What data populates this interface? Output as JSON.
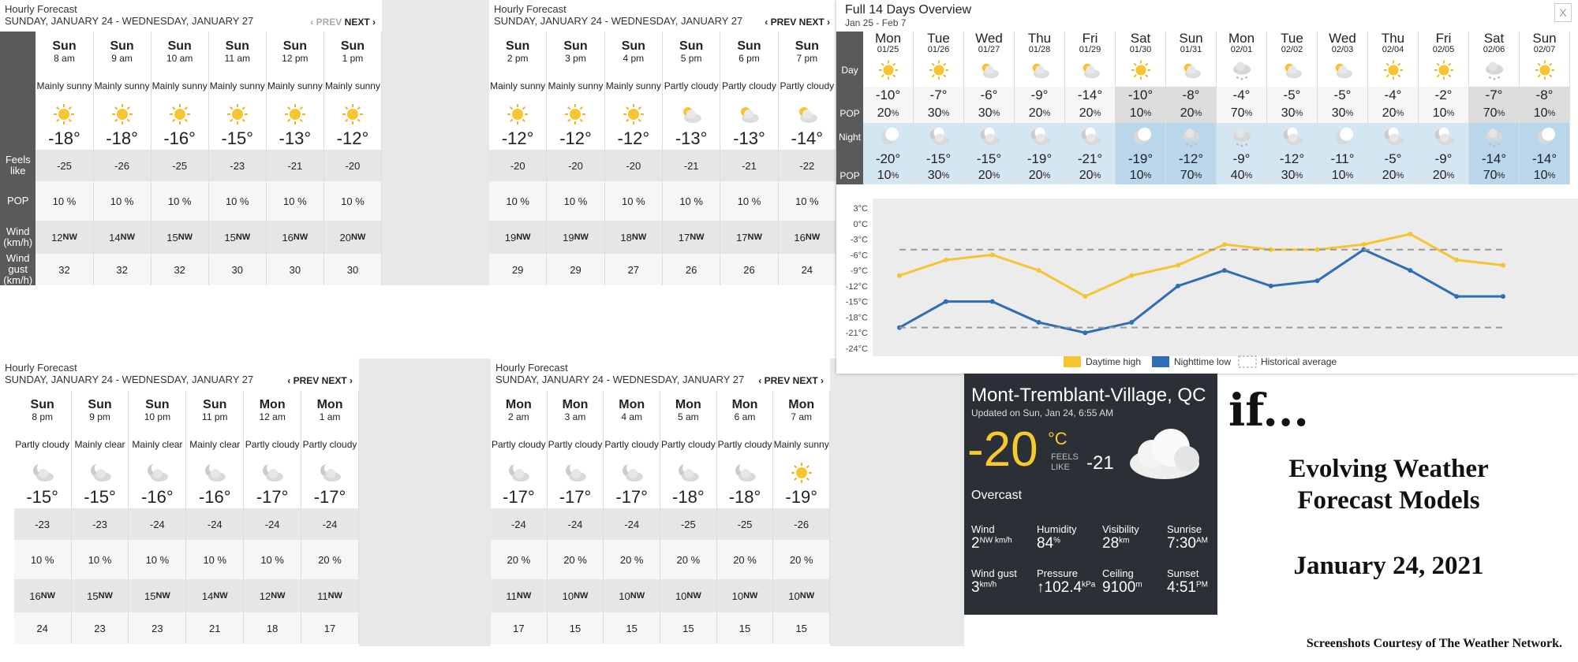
{
  "hourly_common": {
    "title": "Hourly Forecast",
    "subtitle": "SUNDAY, JANUARY 24 - WEDNESDAY, JANUARY 27",
    "prev": "‹ PREV",
    "next": "NEXT ›",
    "labels": {
      "feels": "Feels like",
      "pop": "POP",
      "wind": "Wind (km/h)",
      "gust": "Wind gust (km/h)"
    }
  },
  "panel1": [
    {
      "day": "Sun",
      "time": "8 am",
      "cond": "Mainly sunny",
      "icon": "sun-icon",
      "temp": "-18°",
      "feels": "-25",
      "pop": "10 %",
      "wind": "12",
      "dir": "NW",
      "gust": "32"
    },
    {
      "day": "Sun",
      "time": "9 am",
      "cond": "Mainly sunny",
      "icon": "sun-icon",
      "temp": "-18°",
      "feels": "-26",
      "pop": "10 %",
      "wind": "14",
      "dir": "NW",
      "gust": "32"
    },
    {
      "day": "Sun",
      "time": "10 am",
      "cond": "Mainly sunny",
      "icon": "sun-icon",
      "temp": "-16°",
      "feels": "-25",
      "pop": "10 %",
      "wind": "15",
      "dir": "NW",
      "gust": "32"
    },
    {
      "day": "Sun",
      "time": "11 am",
      "cond": "Mainly sunny",
      "icon": "sun-icon",
      "temp": "-15°",
      "feels": "-23",
      "pop": "10 %",
      "wind": "15",
      "dir": "NW",
      "gust": "30"
    },
    {
      "day": "Sun",
      "time": "12 pm",
      "cond": "Mainly sunny",
      "icon": "sun-icon",
      "temp": "-13°",
      "feels": "-21",
      "pop": "10 %",
      "wind": "16",
      "dir": "NW",
      "gust": "30"
    },
    {
      "day": "Sun",
      "time": "1 pm",
      "cond": "Mainly sunny",
      "icon": "sun-icon",
      "temp": "-12°",
      "feels": "-20",
      "pop": "10 %",
      "wind": "20",
      "dir": "NW",
      "gust": "30"
    }
  ],
  "panel2": [
    {
      "day": "Sun",
      "time": "2 pm",
      "cond": "Mainly sunny",
      "icon": "sun-icon",
      "temp": "-12°",
      "feels": "-20",
      "pop": "10 %",
      "wind": "19",
      "dir": "NW",
      "gust": "29"
    },
    {
      "day": "Sun",
      "time": "3 pm",
      "cond": "Mainly sunny",
      "icon": "sun-icon",
      "temp": "-12°",
      "feels": "-20",
      "pop": "10 %",
      "wind": "19",
      "dir": "NW",
      "gust": "29"
    },
    {
      "day": "Sun",
      "time": "4 pm",
      "cond": "Mainly sunny",
      "icon": "sun-icon",
      "temp": "-12°",
      "feels": "-20",
      "pop": "10 %",
      "wind": "18",
      "dir": "NW",
      "gust": "27"
    },
    {
      "day": "Sun",
      "time": "5 pm",
      "cond": "Partly cloudy",
      "icon": "cloud-icon",
      "temp": "-13°",
      "feels": "-21",
      "pop": "10 %",
      "wind": "17",
      "dir": "NW",
      "gust": "26"
    },
    {
      "day": "Sun",
      "time": "6 pm",
      "cond": "Partly cloudy",
      "icon": "cloud-icon",
      "temp": "-13°",
      "feels": "-21",
      "pop": "10 %",
      "wind": "17",
      "dir": "NW",
      "gust": "26"
    },
    {
      "day": "Sun",
      "time": "7 pm",
      "cond": "Partly cloudy",
      "icon": "cloud-icon",
      "temp": "-14°",
      "feels": "-22",
      "pop": "10 %",
      "wind": "16",
      "dir": "NW",
      "gust": "24"
    }
  ],
  "panel3": [
    {
      "day": "Sun",
      "time": "8 pm",
      "cond": "Partly cloudy",
      "icon": "moon-cloud-icon",
      "temp": "-15°",
      "feels": "-23",
      "pop": "10 %",
      "wind": "16",
      "dir": "NW",
      "gust": "24"
    },
    {
      "day": "Sun",
      "time": "9 pm",
      "cond": "Mainly clear",
      "icon": "moon-cloud-icon",
      "temp": "-15°",
      "feels": "-23",
      "pop": "10 %",
      "wind": "15",
      "dir": "NW",
      "gust": "23"
    },
    {
      "day": "Sun",
      "time": "10 pm",
      "cond": "Mainly clear",
      "icon": "moon-cloud-icon",
      "temp": "-16°",
      "feels": "-24",
      "pop": "10 %",
      "wind": "15",
      "dir": "NW",
      "gust": "23"
    },
    {
      "day": "Sun",
      "time": "11 pm",
      "cond": "Mainly clear",
      "icon": "moon-cloud-icon",
      "temp": "-16°",
      "feels": "-24",
      "pop": "10 %",
      "wind": "14",
      "dir": "NW",
      "gust": "21"
    },
    {
      "day": "Mon",
      "time": "12 am",
      "cond": "Partly cloudy",
      "icon": "moon-cloud-icon",
      "temp": "-17°",
      "feels": "-24",
      "pop": "10 %",
      "wind": "12",
      "dir": "NW",
      "gust": "18"
    },
    {
      "day": "Mon",
      "time": "1 am",
      "cond": "Partly cloudy",
      "icon": "moon-cloud-icon",
      "temp": "-17°",
      "feels": "-24",
      "pop": "20 %",
      "wind": "11",
      "dir": "NW",
      "gust": "17"
    }
  ],
  "panel4": [
    {
      "day": "Mon",
      "time": "2 am",
      "cond": "Partly cloudy",
      "icon": "moon-cloud-icon",
      "temp": "-17°",
      "feels": "-24",
      "pop": "20 %",
      "wind": "11",
      "dir": "NW",
      "gust": "17"
    },
    {
      "day": "Mon",
      "time": "3 am",
      "cond": "Partly cloudy",
      "icon": "moon-cloud-icon",
      "temp": "-17°",
      "feels": "-24",
      "pop": "20 %",
      "wind": "10",
      "dir": "NW",
      "gust": "15"
    },
    {
      "day": "Mon",
      "time": "4 am",
      "cond": "Partly cloudy",
      "icon": "moon-cloud-icon",
      "temp": "-17°",
      "feels": "-24",
      "pop": "20 %",
      "wind": "10",
      "dir": "NW",
      "gust": "15"
    },
    {
      "day": "Mon",
      "time": "5 am",
      "cond": "Partly cloudy",
      "icon": "moon-cloud-icon",
      "temp": "-18°",
      "feels": "-25",
      "pop": "20 %",
      "wind": "10",
      "dir": "NW",
      "gust": "15"
    },
    {
      "day": "Mon",
      "time": "6 am",
      "cond": "Partly cloudy",
      "icon": "moon-cloud-icon",
      "temp": "-18°",
      "feels": "-25",
      "pop": "20 %",
      "wind": "10",
      "dir": "NW",
      "gust": "15"
    },
    {
      "day": "Mon",
      "time": "7 am",
      "cond": "Mainly sunny",
      "icon": "sun-icon",
      "temp": "-19°",
      "feels": "-26",
      "pop": "20 %",
      "wind": "10",
      "dir": "NW",
      "gust": "15"
    }
  ],
  "overview": {
    "title": "Full 14 Days Overview",
    "range": "Jan 25 - Feb 7",
    "close": "X",
    "labels": {
      "day": "Day",
      "pop": "POP",
      "night": "Night"
    },
    "days": [
      {
        "d": "Mon",
        "dt": "01/25",
        "hi": "-10°",
        "dpop": "20",
        "lo": "-20°",
        "npop": "10"
      },
      {
        "d": "Tue",
        "dt": "01/26",
        "hi": "-7°",
        "dpop": "30",
        "lo": "-15°",
        "npop": "30"
      },
      {
        "d": "Wed",
        "dt": "01/27",
        "hi": "-6°",
        "dpop": "30",
        "lo": "-15°",
        "npop": "20"
      },
      {
        "d": "Thu",
        "dt": "01/28",
        "hi": "-9°",
        "dpop": "20",
        "lo": "-19°",
        "npop": "20"
      },
      {
        "d": "Fri",
        "dt": "01/29",
        "hi": "-14°",
        "dpop": "20",
        "lo": "-21°",
        "npop": "20"
      },
      {
        "d": "Sat",
        "dt": "01/30",
        "hi": "-10°",
        "dpop": "10",
        "lo": "-19°",
        "npop": "10"
      },
      {
        "d": "Sun",
        "dt": "01/31",
        "hi": "-8°",
        "dpop": "20",
        "lo": "-12°",
        "npop": "70"
      },
      {
        "d": "Mon",
        "dt": "02/01",
        "hi": "-4°",
        "dpop": "70",
        "lo": "-9°",
        "npop": "40"
      },
      {
        "d": "Tue",
        "dt": "02/02",
        "hi": "-5°",
        "dpop": "30",
        "lo": "-12°",
        "npop": "30"
      },
      {
        "d": "Wed",
        "dt": "02/03",
        "hi": "-5°",
        "dpop": "30",
        "lo": "-11°",
        "npop": "10"
      },
      {
        "d": "Thu",
        "dt": "02/04",
        "hi": "-4°",
        "dpop": "20",
        "lo": "-5°",
        "npop": "20"
      },
      {
        "d": "Fri",
        "dt": "02/05",
        "hi": "-2°",
        "dpop": "10",
        "lo": "-9°",
        "npop": "20"
      },
      {
        "d": "Sat",
        "dt": "02/06",
        "hi": "-7°",
        "dpop": "70",
        "lo": "-14°",
        "npop": "70"
      },
      {
        "d": "Sun",
        "dt": "02/07",
        "hi": "-8°",
        "dpop": "10",
        "lo": "-14°",
        "npop": "10"
      }
    ],
    "pct": "%",
    "legend": {
      "high": "Daytime high",
      "low": "Nighttime low",
      "avg": "Historical average"
    },
    "colors": {
      "high": "#f5c531",
      "low": "#2f6db5"
    }
  },
  "chart_data": {
    "type": "line",
    "x": [
      "01/25",
      "01/26",
      "01/27",
      "01/28",
      "01/29",
      "01/30",
      "01/31",
      "02/01",
      "02/02",
      "02/03",
      "02/04",
      "02/05",
      "02/06",
      "02/07"
    ],
    "series": [
      {
        "name": "Daytime high",
        "values": [
          -10,
          -7,
          -6,
          -9,
          -14,
          -10,
          -8,
          -4,
          -5,
          -5,
          -4,
          -2,
          -7,
          -8
        ]
      },
      {
        "name": "Nighttime low",
        "values": [
          -20,
          -15,
          -15,
          -19,
          -21,
          -19,
          -12,
          -9,
          -12,
          -11,
          -5,
          -9,
          -14,
          -14
        ]
      },
      {
        "name": "Historical average",
        "values": [
          -5,
          -5,
          -5,
          -5,
          -5,
          -5,
          -5,
          -5,
          -5,
          -5,
          -5,
          -5,
          -5,
          -5
        ]
      },
      {
        "name": "Historical average",
        "values": [
          -20,
          -20,
          -20,
          -20,
          -20,
          -20,
          -20,
          -20,
          -20,
          -20,
          -20,
          -20,
          -20,
          -20
        ]
      }
    ],
    "yticks": [
      "3°C",
      "0°C",
      "-3°C",
      "-6°C",
      "-9°C",
      "-12°C",
      "-15°C",
      "-18°C",
      "-21°C",
      "-24°C"
    ],
    "ylim": [
      -24,
      3
    ],
    "legend": "bottom"
  },
  "current": {
    "location": "Mont-Tremblant-Village, QC",
    "updated": "Updated on Sun, Jan 24, 6:55 AM",
    "temp": "-20",
    "unit": "°C",
    "feels_label": "FEELS LIKE",
    "feels": "-21",
    "condition": "Overcast",
    "wind_label": "Wind",
    "wind": "2",
    "wind_unit": "NW km/h",
    "humidity_label": "Humidity",
    "humidity": "84",
    "humidity_unit": "%",
    "visibility_label": "Visibility",
    "visibility": "28",
    "visibility_unit": "km",
    "sunrise_label": "Sunrise",
    "sunrise": "7:30",
    "sunrise_unit": "AM",
    "gust_label": "Wind gust",
    "gust": "3",
    "gust_unit": "km/h",
    "pressure_label": "Pressure",
    "pressure": "↑102.4",
    "pressure_unit": "kPa",
    "ceiling_label": "Ceiling",
    "ceiling": "9100",
    "ceiling_unit": "m",
    "sunset_label": "Sunset",
    "sunset": "4:51",
    "sunset_unit": "PM"
  },
  "side": {
    "if": "if...",
    "title1": "Evolving Weather",
    "title2": "Forecast Models",
    "date": "January 24, 2021",
    "credit": "Screenshots Courtesy of The Weather Network."
  }
}
